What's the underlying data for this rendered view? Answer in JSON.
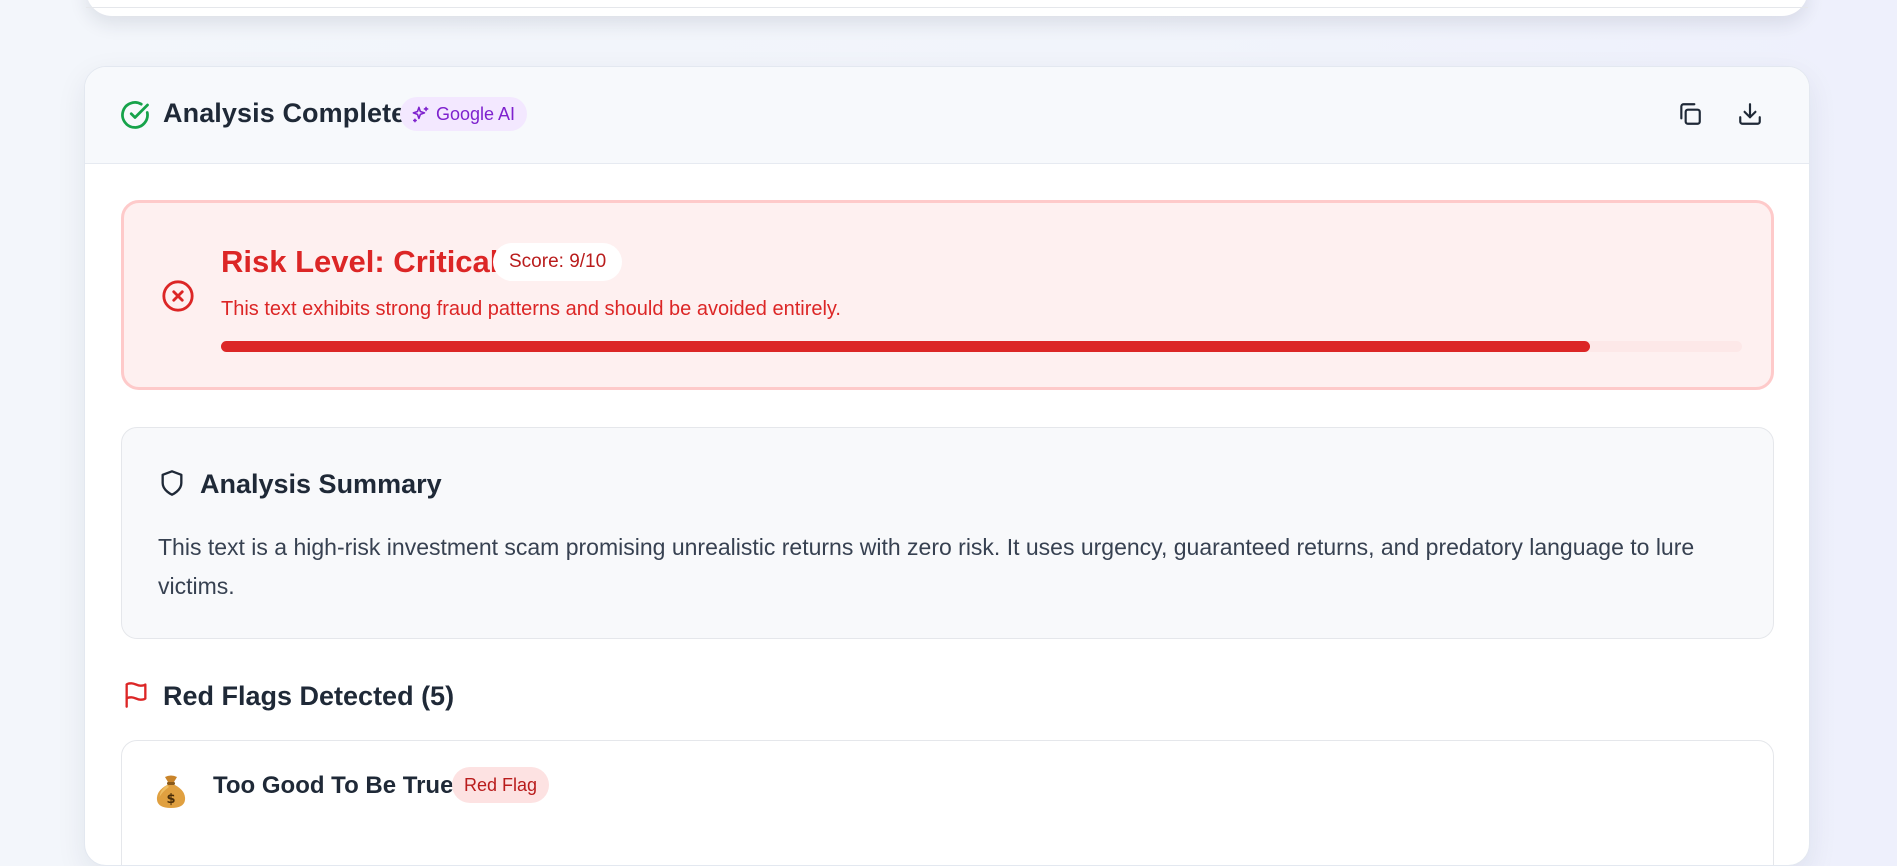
{
  "header": {
    "title": "Analysis Complete",
    "badge": "Google AI",
    "actions": {
      "copy_icon": "copy-icon",
      "download_icon": "download-icon"
    }
  },
  "risk": {
    "title": "Risk Level: Critical",
    "score_label": "Score: 9/10",
    "description": "This text exhibits strong fraud patterns and should be avoided entirely.",
    "progress_fraction": 0.9,
    "colors": {
      "accent": "#dc2626",
      "background": "#fef0f0",
      "border": "#fecaca"
    }
  },
  "summary": {
    "title": "Analysis Summary",
    "text": "This text is a high-risk investment scam promising unrealistic returns with zero risk. It uses urgency, guaranteed returns, and predatory language to lure victims."
  },
  "red_flags": {
    "title": "Red Flags Detected (5)",
    "items": [
      {
        "icon": "money-bag-icon",
        "name": "Too Good To Be True",
        "badge": "Red Flag"
      }
    ]
  }
}
